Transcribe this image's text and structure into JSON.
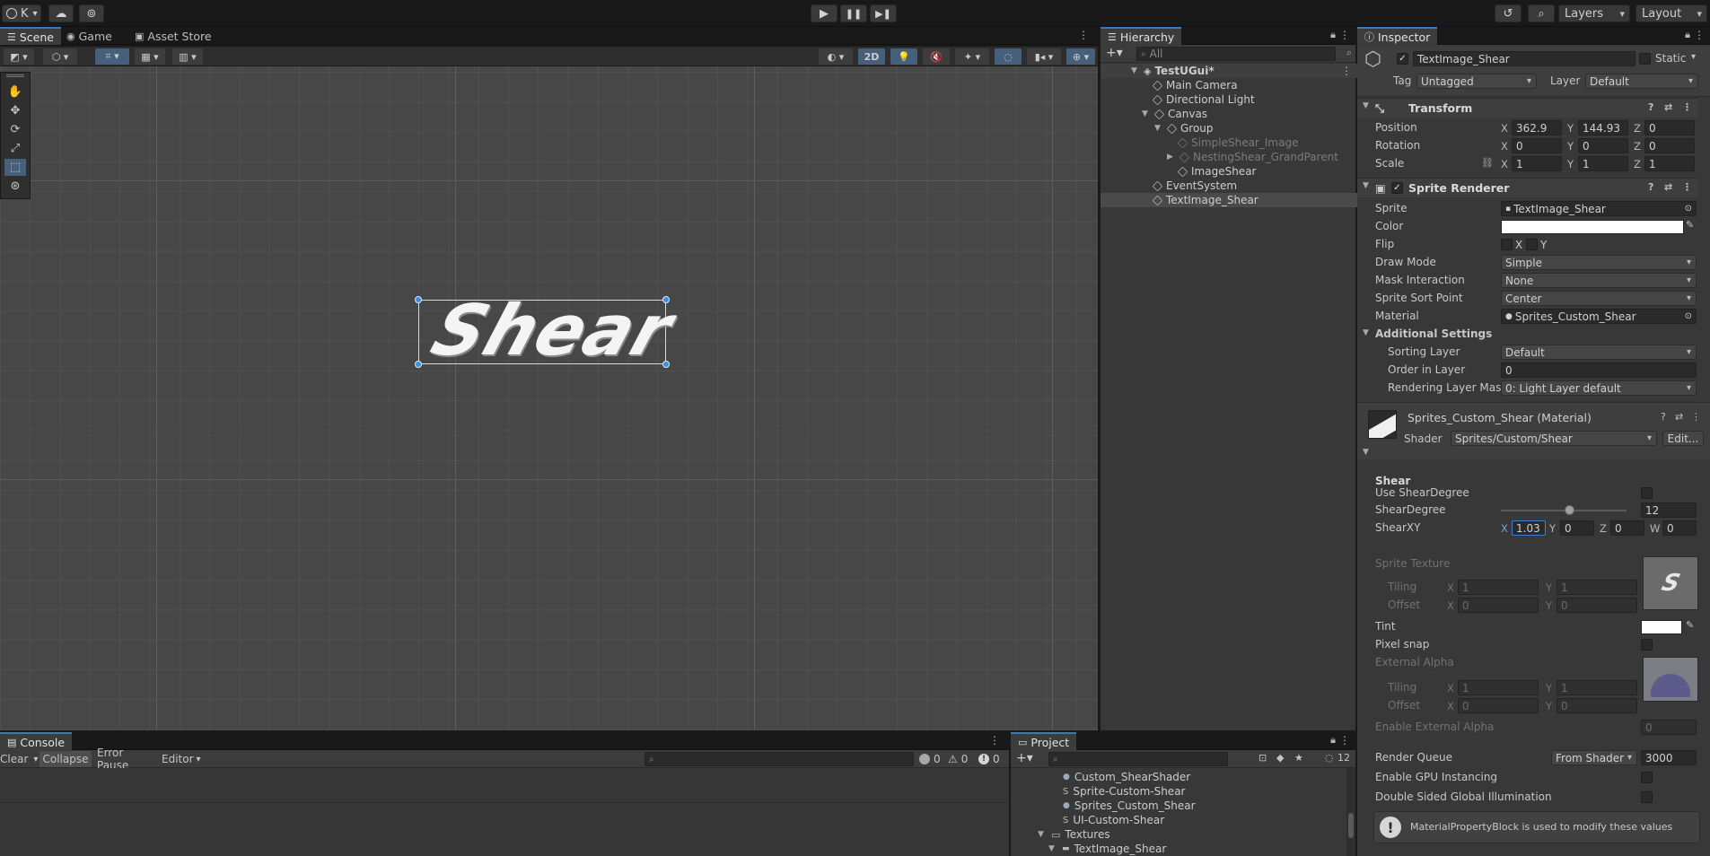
{
  "topbar": {
    "account_label": "K",
    "layers_label": "Layers",
    "layout_label": "Layout"
  },
  "scene_panel": {
    "tabs": [
      "Scene",
      "Game",
      "Asset Store"
    ],
    "toggle_2d": "2D",
    "shear_text": "Shear"
  },
  "hierarchy": {
    "tab": "Hierarchy",
    "search_placeholder": "All",
    "scene_name": "TestUGui*",
    "rows": [
      {
        "label": "Main Camera"
      },
      {
        "label": "Directional Light"
      },
      {
        "label": "Canvas"
      },
      {
        "label": "Group"
      },
      {
        "label": "SimpleShear_Image"
      },
      {
        "label": "NestingShear_GrandParent"
      },
      {
        "label": "ImageShear"
      },
      {
        "label": "EventSystem"
      },
      {
        "label": "TextImage_Shear"
      }
    ]
  },
  "inspector": {
    "tab": "Inspector",
    "object_name": "TextImage_Shear",
    "static_label": "Static",
    "tag_label": "Tag",
    "tag_value": "Untagged",
    "layer_label": "Layer",
    "layer_value": "Default",
    "transform": {
      "title": "Transform",
      "position_label": "Position",
      "rotation_label": "Rotation",
      "scale_label": "Scale",
      "position": {
        "x": "362.9",
        "y": "144.93",
        "z": "0"
      },
      "rotation": {
        "x": "0",
        "y": "0",
        "z": "0"
      },
      "scale": {
        "x": "1",
        "y": "1",
        "z": "1"
      }
    },
    "sprite_renderer": {
      "title": "Sprite Renderer",
      "sprite_label": "Sprite",
      "sprite_value": "TextImage_Shear",
      "color_label": "Color",
      "flip_label": "Flip",
      "flip_x": "X",
      "flip_y": "Y",
      "draw_mode_label": "Draw Mode",
      "draw_mode_value": "Simple",
      "mask_label": "Mask Interaction",
      "mask_value": "None",
      "sort_point_label": "Sprite Sort Point",
      "sort_point_value": "Center",
      "material_label": "Material",
      "material_value": "Sprites_Custom_Shear",
      "additional_label": "Additional Settings",
      "sorting_layer_label": "Sorting Layer",
      "sorting_layer_value": "Default",
      "order_label": "Order in Layer",
      "order_value": "0",
      "rendering_mask_label": "Rendering Layer Mask",
      "rendering_mask_value": "0: Light Layer default"
    },
    "material": {
      "title": "Sprites_Custom_Shear (Material)",
      "shader_label": "Shader",
      "shader_value": "Sprites/Custom/Shear",
      "edit_label": "Edit...",
      "shear_header": "Shear",
      "use_degree_label": "Use ShearDegree",
      "degree_label": "ShearDegree",
      "degree_value": "12",
      "degree_fraction": 0.55,
      "shearxy_label": "ShearXY",
      "shearxy": {
        "x": "1.03",
        "y": "0",
        "z": "0",
        "w": "0"
      },
      "sprite_texture_label": "Sprite Texture",
      "tiling_label": "Tiling",
      "offset_label": "Offset",
      "tiling1": {
        "x": "1",
        "y": "1"
      },
      "offset1": {
        "x": "0",
        "y": "0"
      },
      "tint_label": "Tint",
      "pixel_snap_label": "Pixel snap",
      "external_alpha_label": "External Alpha",
      "tiling2": {
        "x": "1",
        "y": "1"
      },
      "offset2": {
        "x": "0",
        "y": "0"
      },
      "enable_ext_alpha_label": "Enable External Alpha",
      "enable_ext_alpha_value": "0",
      "render_queue_label": "Render Queue",
      "render_queue_mode": "From Shader",
      "render_queue_value": "3000",
      "gpu_instancing_label": "Enable GPU Instancing",
      "double_sided_label": "Double Sided Global Illumination",
      "info_text": "MaterialPropertyBlock is used to modify these values"
    }
  },
  "console": {
    "tab": "Console",
    "clear_label": "Clear",
    "collapse_label": "Collapse",
    "error_pause_label": "Error Pause",
    "editor_label": "Editor",
    "count_log": "0",
    "count_warn": "0",
    "count_error": "0"
  },
  "project": {
    "tab": "Project",
    "hidden_count": "12",
    "items": [
      {
        "label": "Custom_ShearShader"
      },
      {
        "label": "Sprite-Custom-Shear"
      },
      {
        "label": "Sprites_Custom_Shear"
      },
      {
        "label": "UI-Custom-Shear"
      },
      {
        "label": "Textures"
      },
      {
        "label": "TextImage_Shear"
      }
    ]
  }
}
